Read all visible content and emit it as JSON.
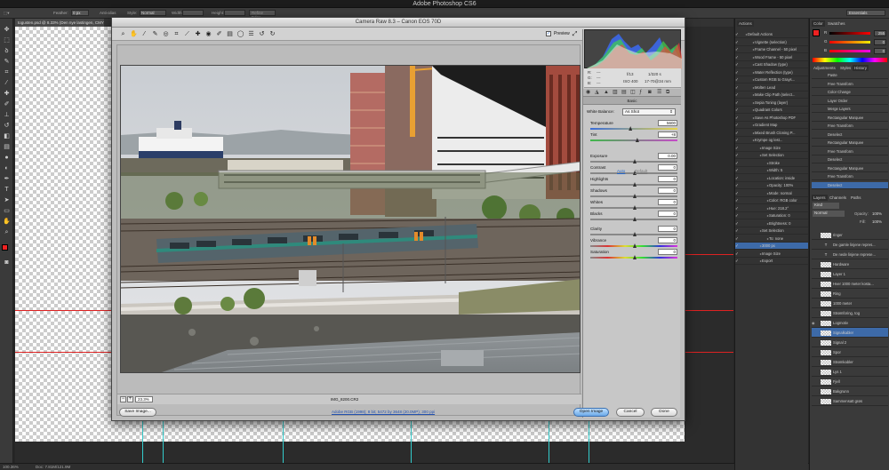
{
  "app": {
    "title": "Adobe Photoshop CS6"
  },
  "options_bar": {
    "feather_label": "Feather:",
    "feather_value": "0 px",
    "antialias_label": "Anti-alias",
    "style_label": "Style:",
    "style_value": "Normal",
    "width_label": "Width:",
    "height_label": "Height:",
    "refine_edge_label": "Refine Edge...",
    "workspace": "Essentials"
  },
  "document": {
    "tab": "togusten.psd @ 8.33% (Den nye lastingen, CMYK/8)"
  },
  "status": {
    "zoom": "100.36%",
    "doc": "Doc: 7.81M/121.9M"
  },
  "dialog": {
    "title": "Camera Raw 8.3  –  Canon EOS 70D",
    "preview_label": "Preview",
    "zoom": "23.3%",
    "filename": "IMG_8200.CR2",
    "workflow_link": "Adobe RGB (1998); 8 bit; 5472 by 3648 (20.0MP); 300 ppi",
    "save_button": "Save Image...",
    "open_button": "Open Image",
    "cancel_button": "Cancel",
    "done_button": "Done"
  },
  "meta": {
    "r": "R:",
    "g": "G:",
    "b": "B:",
    "dashes": "---",
    "aperture": "f/13",
    "shutter": "1/320 s",
    "iso": "ISO 400",
    "lens": "17-70@34 mm"
  },
  "basic": {
    "title": "Basic",
    "white_balance_label": "White Balance:",
    "white_balance_value": "As Shot",
    "auto": "Auto",
    "default": "Default",
    "controls": [
      {
        "label": "Temperature",
        "value": "5600",
        "pos": 0.45
      },
      {
        "label": "Tint",
        "value": "+8",
        "pos": 0.53
      },
      {
        "label": "Exposure",
        "value": "0.00",
        "pos": 0.5
      },
      {
        "label": "Contrast",
        "value": "0",
        "pos": 0.5
      },
      {
        "label": "Highlights",
        "value": "0",
        "pos": 0.5
      },
      {
        "label": "Shadows",
        "value": "0",
        "pos": 0.5
      },
      {
        "label": "Whites",
        "value": "0",
        "pos": 0.5
      },
      {
        "label": "Blacks",
        "value": "0",
        "pos": 0.5
      },
      {
        "label": "Clarity",
        "value": "0",
        "pos": 0.5
      },
      {
        "label": "Vibrance",
        "value": "0",
        "pos": 0.5
      },
      {
        "label": "Saturation",
        "value": "0",
        "pos": 0.5
      }
    ]
  },
  "actions": {
    "tab": "Actions",
    "items": [
      "Default Actions",
      "Vignette (selection)",
      "Frame Channel - 50 pixel",
      "Wood Frame - 50 pixel",
      "Cast Shadow (type)",
      "Water Reflection (type)",
      "Custom RGB to Grays...",
      "Molten Lead",
      "Make Clip Path (select...",
      "Sepia Toning (layer)",
      "Quadrant Colors",
      "Save As Photoshop PDF",
      "Gradient Map",
      "Mixed Brush Cloning P...",
      "Krympe og lest...",
      "Image Size",
      "Set Selection",
      "Stroke",
      "Width: 5",
      "Location: inside",
      "Opacity: 100%",
      "Mode: normal",
      "Color: RGB color",
      "Hue: 218.2°",
      "Saturation: 0",
      "Brightness: 0",
      "Set Selection",
      "To: none",
      "3000 px",
      "Image Size",
      "Export"
    ]
  },
  "color_panel": {
    "tabs": [
      "Color",
      "Swatches"
    ],
    "channels": [
      {
        "name": "R",
        "value": "255"
      },
      {
        "name": "G",
        "value": "0"
      },
      {
        "name": "B",
        "value": "0"
      }
    ]
  },
  "history": {
    "tabs": [
      "Adjustments",
      "Styles",
      "History"
    ],
    "items": [
      "Paste",
      "Free Transform",
      "Color Change",
      "Layer Order",
      "Merge Layers",
      "Rectangular Marquee",
      "Free Transform",
      "Deselect",
      "Rectangular Marquee",
      "Free Transform",
      "Deselect",
      "Rectangular Marquee",
      "Free Transform",
      "Deselect"
    ]
  },
  "layers": {
    "tabs": [
      "Layers",
      "Channels",
      "Paths"
    ],
    "kind": "Kind",
    "blend": "Normal",
    "opacity_label": "Opacity:",
    "opacity_value": "100%",
    "fill_label": "Fill:",
    "fill_value": "100%",
    "items": [
      "ringer",
      "De gamle linjene repres...",
      "De nede linjene represe...",
      "Hardware",
      "Layer 1",
      "Hver 1000 meter kosta...",
      "Ring",
      "1000 meter",
      "Strømforing, tog",
      "Logmotiv",
      "Signalkabler",
      "Signal 2",
      "Spor",
      "Strømkabler",
      "Lys 1",
      "Fjell",
      "Bakgrunn",
      "Sammensatt grøs"
    ]
  },
  "colors": {
    "accent_red": "#e22222",
    "selected_blue": "#3d6aa8"
  }
}
